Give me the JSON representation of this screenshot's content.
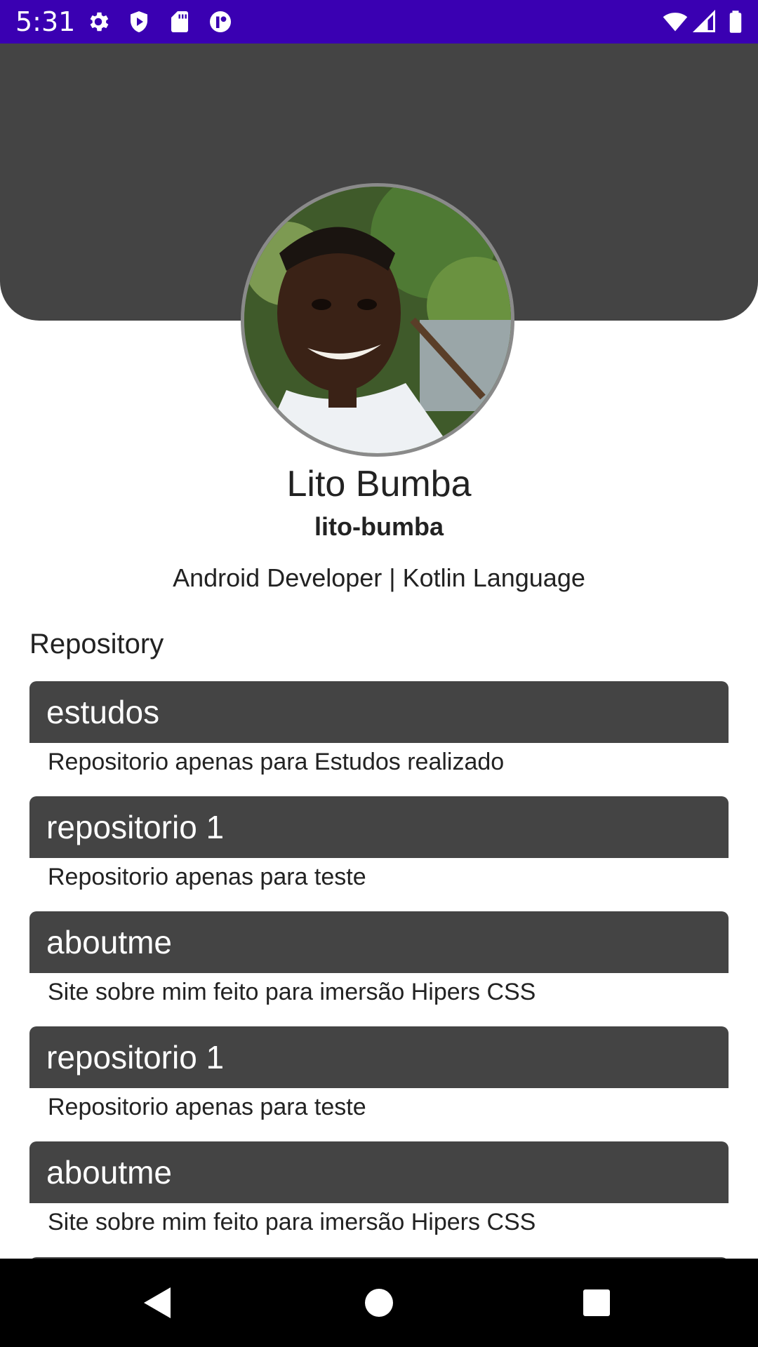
{
  "status_bar": {
    "time": "5:31",
    "icons_left": [
      "settings-icon",
      "play-protect-icon",
      "sd-card-icon",
      "app-notification-icon"
    ],
    "icons_right": [
      "wifi-icon",
      "signal-icon",
      "battery-icon"
    ],
    "background": "#3a00b2"
  },
  "profile": {
    "name": "Lito Bumba",
    "login": "lito-bumba",
    "bio": "Android Developer | Kotlin Language",
    "header_color": "#444444"
  },
  "section": {
    "title": "Repository"
  },
  "repositories": [
    {
      "name": "estudos",
      "description": "Repositorio apenas para Estudos realizado"
    },
    {
      "name": "repositorio 1",
      "description": "Repositorio apenas para teste"
    },
    {
      "name": "aboutme",
      "description": "Site sobre mim feito para imersão Hipers CSS"
    },
    {
      "name": "repositorio 1",
      "description": "Repositorio apenas para teste"
    },
    {
      "name": "aboutme",
      "description": "Site sobre mim feito para imersão Hipers CSS"
    }
  ],
  "nav_bar": {
    "buttons": [
      "back-icon",
      "home-icon",
      "recents-icon"
    ]
  }
}
